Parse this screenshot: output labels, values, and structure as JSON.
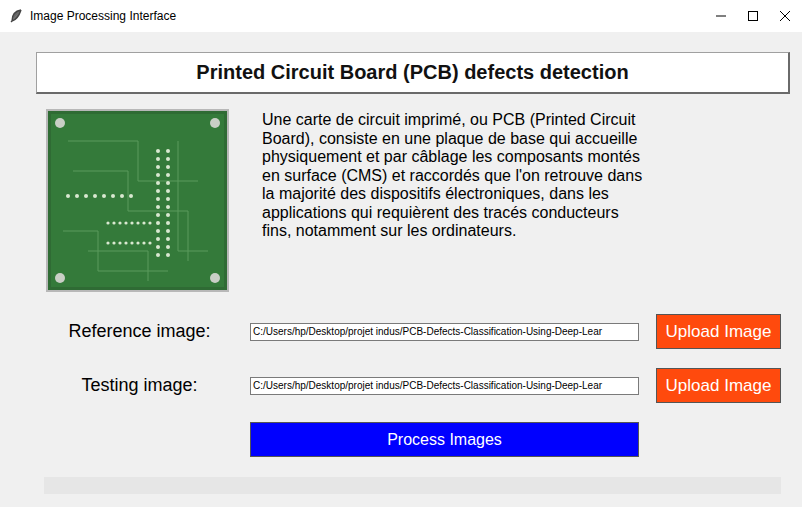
{
  "window": {
    "title": "Image Processing Interface"
  },
  "header": {
    "title": "Printed Circuit Board (PCB) defects detection"
  },
  "intro": {
    "text": "Une carte de circuit imprimé, ou PCB (Printed Circuit Board), consiste en une plaque de base qui accueille physiquement et par câblage les composants montés en surface (CMS) et raccordés que l'on retrouve dans la majorité des dispositifs électroniques, dans les applications qui requièrent des tracés conducteurs fins, notamment sur les ordinateurs."
  },
  "uploads": [
    {
      "label": "Reference image:",
      "path": "C:/Users/hp/Desktop/projet indus/PCB-Defects-Classification-Using-Deep-Lear",
      "button": "Upload Image"
    },
    {
      "label": "Testing image:",
      "path": "C:/Users/hp/Desktop/projet indus/PCB-Defects-Classification-Using-Deep-Lear",
      "button": "Upload Image"
    }
  ],
  "process_button": "Process Images"
}
